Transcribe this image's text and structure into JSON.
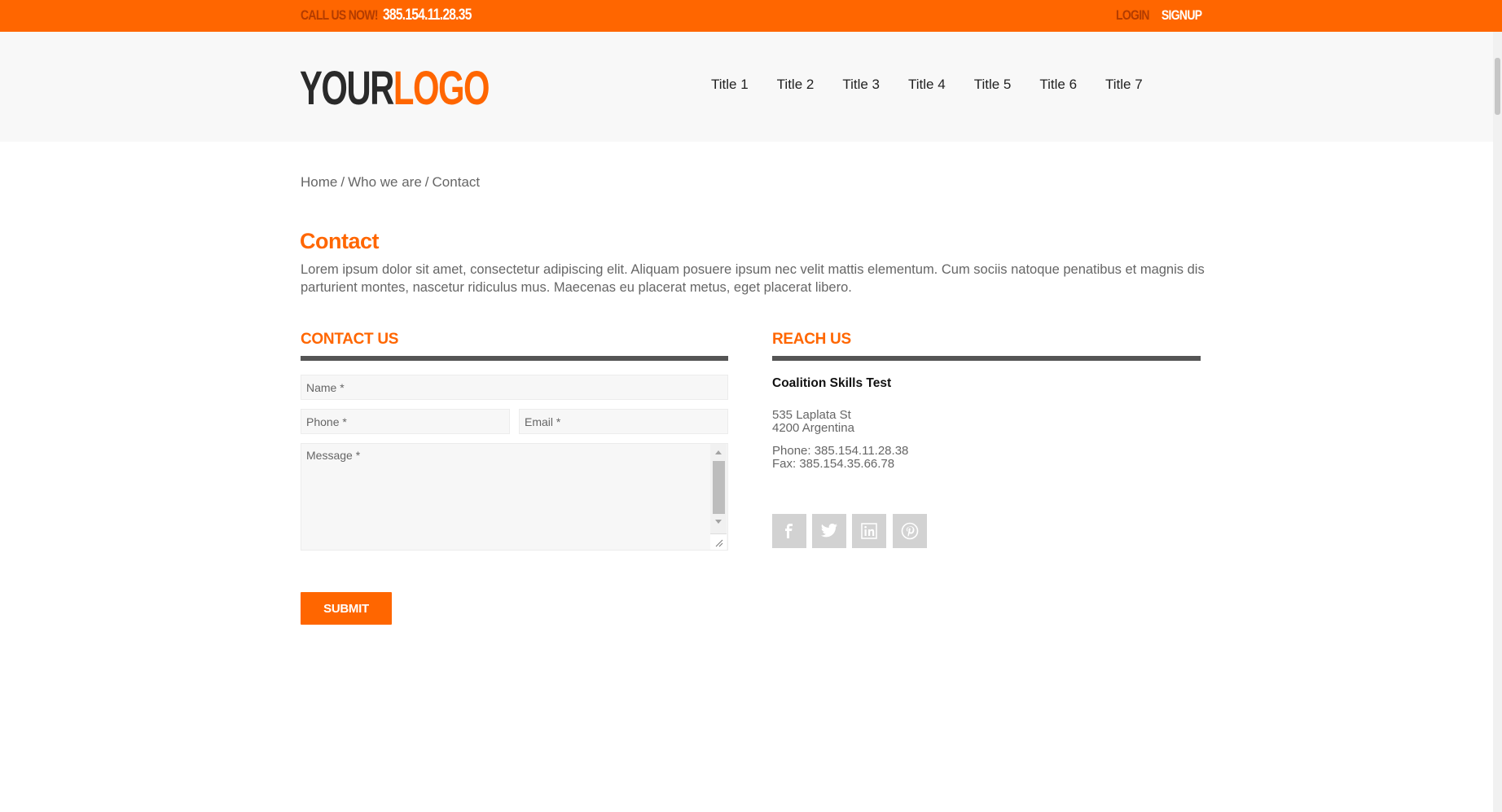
{
  "topbar": {
    "call_label": "CALL US NOW!",
    "phone": "385.154.11.28.35",
    "login": "LOGIN",
    "signup": "SIGNUP"
  },
  "header": {
    "logo_part1": "YOUR",
    "logo_part2": "LOGO",
    "nav": [
      "Title 1",
      "Title 2",
      "Title 3",
      "Title 4",
      "Title 5",
      "Title 6",
      "Title 7"
    ]
  },
  "breadcrumb": {
    "items": [
      "Home",
      "Who we are",
      "Contact"
    ],
    "separator": "/"
  },
  "main": {
    "title": "Contact",
    "intro": "Lorem ipsum dolor sit amet, consectetur adipiscing elit. Aliquam posuere ipsum nec velit mattis elementum. Cum sociis natoque penatibus et magnis dis parturient montes, nascetur ridiculus mus. Maecenas eu placerat metus, eget placerat libero."
  },
  "contact_form": {
    "heading": "CONTACT US",
    "name_placeholder": "Name *",
    "phone_placeholder": "Phone *",
    "email_placeholder": "Email *",
    "message_placeholder": "Message *",
    "submit_label": "SUBMIT"
  },
  "reach_us": {
    "heading": "REACH US",
    "company": "Coalition Skills Test",
    "address_line1": "535 Laplata St",
    "address_line2": "4200 Argentina",
    "phone": "Phone: 385.154.11.28.38",
    "fax": "Fax: 385.154.35.66.78",
    "social": [
      "facebook-icon",
      "twitter-icon",
      "linkedin-icon",
      "pinterest-icon"
    ]
  },
  "colors": {
    "accent": "#ff6600",
    "rule": "#555555",
    "header_bg": "#f8f8f8",
    "social_bg": "#d2d2d2"
  }
}
